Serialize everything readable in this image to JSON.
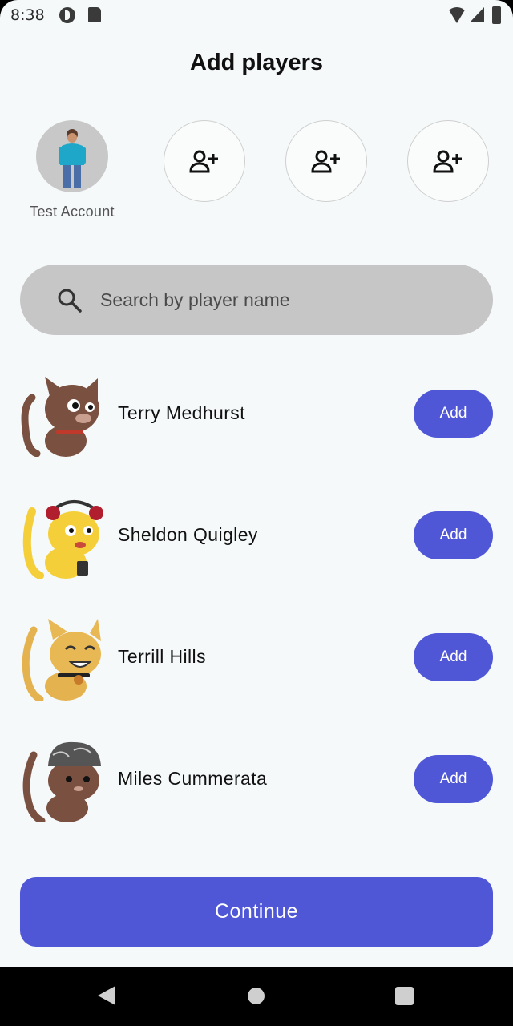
{
  "status_bar": {
    "time": "8:38"
  },
  "header": {
    "title": "Add players"
  },
  "selected_players": [
    {
      "name": "Test Account",
      "filled": true
    }
  ],
  "empty_slots": [
    {
      "icon": "add-person-icon"
    },
    {
      "icon": "add-person-icon"
    },
    {
      "icon": "add-person-icon"
    }
  ],
  "search": {
    "placeholder": "Search by player name",
    "value": ""
  },
  "players": [
    {
      "name": "Terry Medhurst",
      "add_label": "Add"
    },
    {
      "name": "Sheldon Quigley",
      "add_label": "Add"
    },
    {
      "name": "Terrill Hills",
      "add_label": "Add"
    },
    {
      "name": "Miles Cummerata",
      "add_label": "Add"
    }
  ],
  "footer": {
    "continue_label": "Continue"
  },
  "colors": {
    "accent": "#4f57d6",
    "background": "#f5f9fa",
    "search_bg": "#c6c6c6"
  }
}
